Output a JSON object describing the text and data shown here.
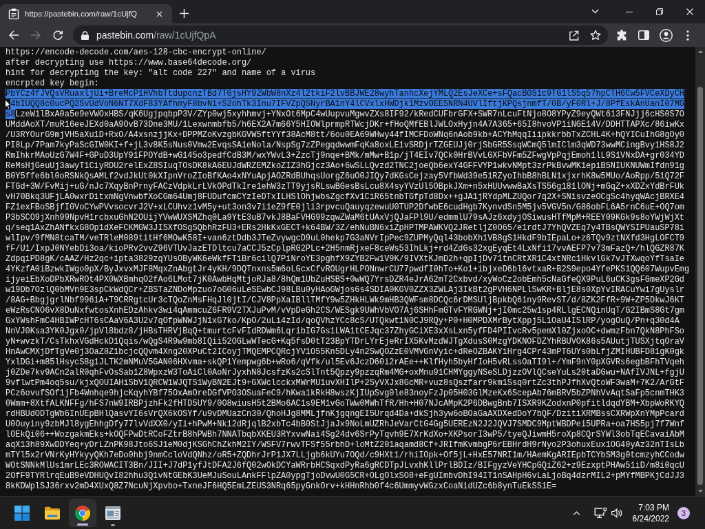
{
  "browser": {
    "tab": {
      "title": "https://pastebin.com/raw/1cUjfQ",
      "selected": true
    },
    "nav_buttons": [
      {
        "kind": "back",
        "disabled": false
      },
      {
        "kind": "forward",
        "disabled": true
      },
      {
        "kind": "reload",
        "disabled": false
      }
    ],
    "address_bar": {
      "domain": "pastebin.com",
      "path": "/raw/1cUjfQpA"
    }
  },
  "document": {
    "lines": [
      [
        {
          "text": "https://encode-decode.com/aes-128-cbc-encrypt-online/",
          "selected": false
        }
      ],
      [
        {
          "text": "after decrypting use https://www.base64decode.org/",
          "selected": false
        }
      ],
      [
        {
          "text": "hint for decrypting the key: \"alt code 227\" and name of a virus",
          "selected": false
        }
      ],
      [
        {
          "text": "encrpted key begin:",
          "selected": false
        }
      ],
      [
        {
          "text": "PbYCz4fJVQsVRuaxljUi+BreMcP1HVhbTtdupcnzTBd7TGjsHY92WbW8nXz4l2tkiF2lvBBJWE28wyhTanhcXejYMLQ2EsJeXCe+sFQacBOS1c9TG1lS5q57hpCTH6Cw5FVCeXDyCH",
          "selected": true
        }
      ],
      [
        {
          "text": "4bIUQQ8c0ucPQ2SvUdVoN6NT7XdF83YAfhmyF8bvNi+S2ohTk3Inu7IFVZpQSNyrBA1nY4lCVxlxHWDjk1MzvOEESNRN4UVlIftjKPQsjnmfT/0B/yF0Rl+J/8PfEskAnUanI07MG",
          "selected": true
        }
      ],
      [
        {
          "text": "s8",
          "selected": true
        },
        {
          "text": "LzeW1lBxA0a5e9eVWOxHBS/qK6UgjpqbpP3V/ZYp0wj5xyhhmvj+YNxOt6MpC4wUupvuMgwvZXs8IF92/kRedCUFbrGFX+SWR7nLcuFtNjo8O8YPyZ9eyQWt613FNJjj6cHS0S7O",
          "selected": false
        }
      ],
      [
        {
          "text": "UMddAoXT/muR16eeJEXd0aA9OvB73Dne3MU/1Lexwnmbfb5/h6EX2A7m66Y5HIOWlprmpRTWcjDKr+fHoQMfEBlJWLOxHyjn4A7A365+65I8hvoVP1iNGE14V/DDHTTAPXc/86iwKx",
          "selected": false
        }
      ],
      [
        {
          "text": "/U3RYOurG9mjVH5aXu1D+RxO/A4xsnzjjKx+DPPMZoKvzgbKGVW5ftYYf38AcM8tt/6ou0EA69WHwy44fIMCFDoWNq6nAob9kb+ACYhMqqIiipkkrbbTxZCHL4K+hQYICuIhG8gOy0",
          "selected": false
        }
      ],
      [
        {
          "text": "PI8Lp/7Pam7kyPaScGIW0KI+f+jL3v8K5sNus0Vmw2EvqsSA1eNola/NspSg7zZPegqdwwmFqKa8oxLE1vSRDjrTZGEUJj0rjSbGR5SsqWCmQ5lmIClm3qWD73wwMCingBvy1HS8J2",
          "selected": false
        }
      ],
      [
        {
          "text": "RmIhkrMAoUzG7W4F+GPuD3UpY91FPOYdB+wG145o3pedfCdB3M/wxYWvL3+ZzcTj9nqe+BMk/mMw+B1p/jT4EIv7QCk0HrBVvLGXFbVFm5ZFwgVpPqjEmoh1lL9S1VNxDA+gr034YD",
          "selected": false
        }
      ],
      [
        {
          "text": "ReMsHjGeuUj3awyT1CiyRDU2relExZ8SIuqTOsDK8kA6EUJdWRZEMZkoZIZ3hGjcz3Ao+6wSLLQvzd2TNC2joeQb6exY4GFFVYP1wkvNMpt3zrPkBvwMK1epiB5NIUKNUWmIfdn91g",
          "selected": false
        }
      ],
      [
        {
          "text": "B0Y5ffe6bl0oRSNkQsAMLf2vdJkUt0kXIpnVroZIoBfKAo4xNYuApjAOZRdBUhqsUorgZ6uO0JIQy7dKGsCejzay5VfbWd39e51RZyoIhbB8hBLN1xjxrhK8w5MUo/AoRpp/51Q72F",
          "selected": false
        }
      ],
      [
        {
          "text": "FTGd+3W/FvMij+uG/nJc7XqyBnPrnyFACzVdpkLrLVkOPdTkIre1ehW3zTT9yjsRLswBGesBsLcu8X4syYVzUl5OBpkJXm+n5xHUUvwwBaXsTS56g181lONj+mGqZ+xXDZxYdBrFUk",
          "selected": false
        }
      ],
      [
        {
          "text": "vH70Bkq3UFjLA0wxrDitxmNgVnwbfXoCGm64Umj8FUDufcmCYzIeDTxILHSlOhjwbsZgcfXv1CiR65tnbTGfpTd8Dx++gJA1jRYdpMLZUQor7q2X+SNisvzeOCgSc4hyqWAcjBRXE4",
          "selected": false
        }
      ],
      [
        {
          "text": "FZ1exFBoSBjfI0VoCYwPVvsocvrJ2V+xLCUhvz1vM5y+ut3on3v7i1eZ9fE0jli3rpvcuQauyqzewuU0TUP2DfwbE6cudHgb7KynvdSn5M5jv5VGV5n/G86obFL6A5rnC6uE+OQ7om",
          "selected": false
        }
      ],
      [
        {
          "text": "P3bSCO9jXnh99NpvH1rcbxuGhN2OUijYVwWUXSMZhq0La9YtE3uB7vkJ8BaFVHG99zqwZWaM6tUAxVjQJaFPl9U/edmmlU79sAJz6xdyjOSiwusHTfMpM+REEY09KGk9s8oYWjWjXt",
          "selected": false
        }
      ],
      [
        {
          "text": "q/seq1AxZhANfkxG8Op1dXeFCKMGW3JISXfOSgSQbhRzFU3+ERs2HkKxGECT+k64BW/3Z/ehNuBN6xiZpHPTMPAWKVQ2JRetljZ0O65/e1rdtJ7YhQVZEq7y4TBsQWYSIPUauSP78i",
          "selected": false
        }
      ],
      [
        {
          "text": "wlIpv/9fMN8tcaTM/veTRleM089titHf6MOwK58I+van6ztDdb3JTeZvywgcD9uL0hekp7G3aNVrIpPec9ZUPMyQql43bobXh1VB8gS1HkdF9bIEpaLo+z6TQv9ztNXfd3HgLOFCT9",
          "selected": false
        }
      ],
      [
        {
          "text": "fF/U1/IxpJ0NYebDi3oa/kioPRv2vvZ96VTUvJazETDltcu7aCCJ5zCplpRG2PLc+2H5nmRjxeF8ceWs53IhLkj+rd4ZdGs32xgEyqEt4LxNfi17vvAEFP7v73mFazQ+/hlQGZR87K",
          "selected": false
        }
      ],
      [
        {
          "text": "ZdpqiPD8gK/cAAZ/Hz2qc+ipta3829zqYUsOByWK6eWkfFTiBr6cilQ7PiNroYE3pghfX9ZYB2Fw1V9K/9IVXtKJmD2h+qpIjDv71tnCRtXR1C4xtNRc1HkvlGk7vJTXwqoYfTsaIe",
          "selected": false
        }
      ],
      [
        {
          "text": "4YKzfA0iBzwkIWgo0pX/ByJxvxMJF8MqxZnAbgtJr4yKH/9DQTnxns5m6oLGcxCfvROUgrHLPONnwrCU77pwdfI0hTo+Ko1+ibjxeD6bl6vtxaR+B2S9epo4YfePKS1QQ607WupvEmg",
          "selected": false
        }
      ],
      [
        {
          "text": "ijyeiEbXoDPbXRwROt4PX0WXBmhqO2fAo6LMot7jK0AwbHqMtjoRJa8/8hQm1UbZuHSBS+0wWQ7YrsDZR4eJrA62mT2Cxbvd/xyWoCz2obEmh5cNaGfeQX9PuL6uCK3gsFGmeXP2Gd",
          "selected": false
        }
      ],
      [
        {
          "text": "w19Db7OzlQ0bMVn9E3spCkWdQCr+ZBSTaZNDoMpzuo7oG06uLeSEwbCJ98LBu0yHAoGWjos6s4SDIA0KGV0ZZX3ZWLAj3IkBt2gPVH6NPLlSwKR+BljE8s0XpYvIRACuYwi7gUyslr",
          "selected": false
        }
      ],
      [
        {
          "text": "/8AG+BbgjgrlNbf9961A+T9CRRgtcUr3cTQoZnMsFHqJl0jtI/CJV8PpXaIBllTMfY9w5ZHkHLWk9mHB3QWFsm8DCQc6rDMSUljBpkbQ61ny9RevST/d/8ZK2FfR+9W+ZP5DkwJ6KT",
          "selected": false
        }
      ],
      [
        {
          "text": "eWzRsCNO6vX8DuNxfwtosXnhEDzAhkv3wi4qAmmcuZ6FR9V2TXJuPvM/vVpDeGh2CS/WESgk9UWhVbVO7Aj6SHhFmGTvFYRGWNj+jI0mc25w1sp4RLlgECNQinUqT/G2IBmS8Gt7gm",
          "selected": false
        }
      ],
      [
        {
          "text": "GxYWshFmC4HBIWPcHT6sCAaV6A3U2v7qOfpWNWJjN1xG7ko/KpO/2uLi4zId/qoQVhzYCc8cS/UTQkwt1N0CJ9RQy+P0+H0MPDXMrBytXppj5L1OaU4ISlRP/yogOuQ/Pn+q30d4A",
          "selected": false
        }
      ],
      [
        {
          "text": "NnVJ0Ksa3YK0Jgx0/jpVl8bdz8/jHBsTHRVjBqQ+tmurtcFvFIdRDWm6LqribIG7Gs1LWA1tCEJqc37ZhyGCiXE3xXsLxn5yfFD4PIIvcRv5pemXl0ZjxoOC+dwmzFbn7QkN8PhFSo",
          "selected": false
        }
      ],
      [
        {
          "text": "yN+wvzkT/CsTkhxVGdHckD1Qqis/wQgS4R9w9mb8IQii52OGLwWTecG+Kq5fsD0tT23BpYTDrLYrEjeRrIX5KvMzdWJTgXdusS0MzgYDKNOFDZYhRBUVOK86s5AUutjTUSXjtqOraV",
          "selected": false
        }
      ],
      [
        {
          "text": "HnAwCMXjDfTgVe0j3OaZ8Z1bcjcQQvm4Xng20XPuCt2ICoyjTMQEMPCQRcjYV1O55Kn5DLy4n2SwQOZzE0VMVGnVyic+dReOZBAKYiHrg4CPr43mPT6UYs0bLfjZMIHUBFD81gK0gk",
          "selected": false
        }
      ],
      [
        {
          "text": "YxlDGi+m85lHsycS8g1JLTK2mNMuV5GAN06HXvma+skQP1Yempwg6b+wRo6/qVfk/ul5Ev6JczD60i2rAEe++KlfHyh5byHfIoH5vRLssOaTI9l+/YmF9nY0pXGVRs6egbBFhTVqeh",
          "selected": false
        }
      ],
      [
        {
          "text": "j0ZDe7kv9ACn2alR0qhFvOsSab1Z8WpxzW3ToAiCl0AoNrJyxhN8JcsfzKs2cSlTnt5Qpzy9pzzqRm4MG+oxMnu91CHMYggyNSeSLDjzzOVlQCseYuLs20taDGwu+NAfIVJNL+fgjU",
          "selected": false
        }
      ],
      [
        {
          "text": "9vflwtPm4oq5su/kjxQOUIAHiSbV1QRCW1WJQTS1WyBN2EJt9+GXWclcckxMWrMU1uvXHIlP+2SyVXJx8GcMR+vuz8sQszfarr9km1Ssq0rtZc3thPJfhXvQtoWF3waM+7K2/ArGtF",
          "selected": false
        }
      ],
      [
        {
          "text": "PCz6ovufSOf1jFb4Wnhqe9hjcKqyhYBf75OxAmOreDGfVPO3OSuaFeC9/hKwa1kRkH8wszKjIUpSvg0le83noyFzJp05H03GlMzeKx6ScepAb76mBRV5bZPNhVvAqtSaFp5cnmTHK3",
          "selected": false
        }
      ],
      [
        {
          "text": "0Wmm+8XtfALKNFFg/hFS7nW9IRBPjzhFk2fHTD5UY9/0O8wiusH5t2BMo6AC1s9EM1vGoTWw0MWhTfR/Hh+H07NJcAMpK2P6DBwgBnb7ISXR9KZodxnP0pfitldqdYBM+XbpWoRKYQ",
          "selected": false
        }
      ],
      [
        {
          "text": "rdHBUdODTgWb6InUEpBHlQasvYI6sVrQX6kOSYf/u9vDMUazCn30/QhoHJg8MMLjfnKjgqngEI5Urqd4Da+dkSjh3yw6oBOaGaAXDXedDoY7bQF/DzitiXRMBssCXRWpXnYMpPcard",
          "selected": false
        }
      ],
      [
        {
          "text": "U0Ouyiny9zbMJl8ygEhhgDfy77lvVdXX0/yIi+hPwM+Nk12dRjqlB2xbTc4bB0StJjaJx9NoLmUZRhJeVarCtG4Gg5UEREzN2J2JQVJ7SMDC9MptWBDPei5UPRa+oa7HS5pj7f7Wnf",
          "selected": false
        }
      ],
      [
        {
          "text": "lOEkQi06++WozgakmEks+kOQFPwDtRCoFZtrB8hPWBh7NNATbqbXKEU3RYxvwNai4Sg24dv6SrPyTqvh9E7XrKdXo+XKPsorI3wP5/tyeQJiwmH5roXp8CQrSYWl3obTqECavaiAbM",
          "selected": false
        }
      ],
      [
        {
          "text": "aqX13h89XwDDYeq+yDrLZnPK98Jto6SJ1eM0djKSGhChZkhM2IY/WSFV7rwvTFSf55rbhD+loMtZ201aqamd8Cf+JRIfmKvmbgP6rEBHrdH9rNyo2P3ohuxEux1OG40yAz32nTIsLb",
          "selected": false
        }
      ],
      [
        {
          "text": "mTYl5x2rVNrKyHYkyyQKh7eDo0hbj9nmCcloVdQNhz/oR5+ZQDhrJrP1JX7LLjgb6kUYu7OQd/c9HXt1/rhiIOpk+Of5jL+HxE57NRI1m/HAemKgARIEpbTCYbSM3g0tcmzyhCCodw",
          "selected": false
        }
      ],
      [
        {
          "text": "WOtSNNkMlUs1mrLEc3ROWACIT3Bn/JII+J7dP1yfJtDFA2J6fQ02wOkDCYaWRrbHCSqxdPyRa6gRCDTpJLvxhKllPrlBDIz/BIFgyzVeYHCpGQiZ62+z9EzxptPHAw51iD/m8i0qcU",
          "selected": false
        }
      ],
      [
        {
          "text": "2OfF9TYRlrqEuB9eVDHUQvI82hhu3Q1vNtGEbK3UeMJuSouLAnkFFlpZA0ypgTjoDvwU0G5CR+OLgOlxSO8+eFgUImbvDhI94IT1nSAHpH6vLaLjoBq4dzrMIL2+pMYfMBPKjCdJJ3",
          "selected": false
        }
      ],
      [
        {
          "text": "8kKDWplSJ36rxv2mD4XUxQ8Z7NcuNjXpvbo+TxneJF6HQ5EmLZEUS3NRq65pyGnkOrv+kHHnRhb0f4c6UmmyvWGzxCoaNidUZc6b8ynTuEkSS1E=",
          "selected": false
        }
      ]
    ]
  },
  "taskbar": {
    "apps": [
      {
        "kind": "start",
        "open": false,
        "active": false
      },
      {
        "kind": "folder",
        "open": false,
        "active": false
      },
      {
        "kind": "browser",
        "open": true,
        "active": true
      },
      {
        "kind": "window",
        "open": true,
        "active": false
      }
    ],
    "clock": {
      "time": "7:03 PM",
      "date": "6/24/2022"
    },
    "notification_count": "3"
  }
}
